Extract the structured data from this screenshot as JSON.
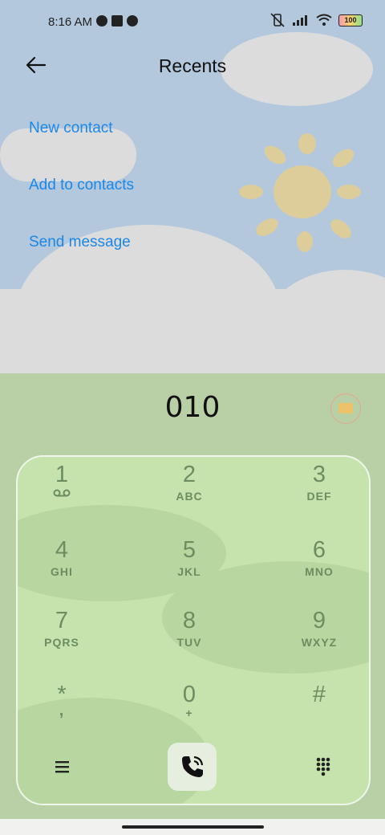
{
  "status_bar": {
    "time": "8:16 AM",
    "battery": "100"
  },
  "header": {
    "title": "Recents"
  },
  "menu": {
    "new_contact": "New contact",
    "add_to_contacts": "Add to contacts",
    "send_message": "Send message"
  },
  "dialer": {
    "number": "010",
    "keys": [
      {
        "digit": "1",
        "letters": ""
      },
      {
        "digit": "2",
        "letters": "ABC"
      },
      {
        "digit": "3",
        "letters": "DEF"
      },
      {
        "digit": "4",
        "letters": "GHI"
      },
      {
        "digit": "5",
        "letters": "JKL"
      },
      {
        "digit": "6",
        "letters": "MNO"
      },
      {
        "digit": "7",
        "letters": "PQRS"
      },
      {
        "digit": "8",
        "letters": "TUV"
      },
      {
        "digit": "9",
        "letters": "WXYZ"
      },
      {
        "digit": "*",
        "letters": ","
      },
      {
        "digit": "0",
        "letters": "+"
      },
      {
        "digit": "#",
        "letters": ""
      }
    ]
  },
  "colors": {
    "link": "#1b87e6",
    "key_text": "#6b8d60"
  }
}
